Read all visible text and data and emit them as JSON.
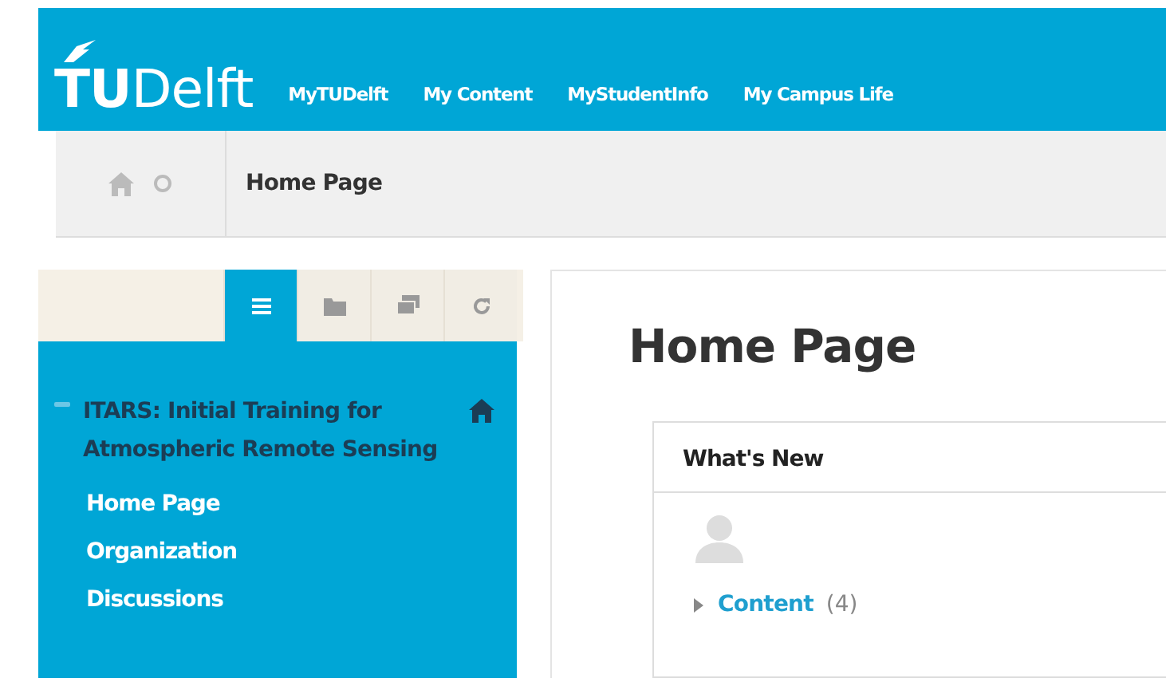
{
  "header": {
    "logo": "TUDelft",
    "nav": [
      "MyTUDelft",
      "My Content",
      "MyStudentInfo",
      "My Campus Life"
    ]
  },
  "breadcrumb": {
    "title": "Home Page"
  },
  "sidebar": {
    "tools": [
      {
        "kind": "list",
        "selected": true
      },
      {
        "kind": "folder",
        "selected": false
      },
      {
        "kind": "stack",
        "selected": false
      },
      {
        "kind": "refresh",
        "selected": false
      }
    ],
    "tree": [
      {
        "label": "ITARS: Initial Training for Atmospheric Remote Sensing",
        "expanded": true,
        "children": [
          {
            "label": "Home Page"
          },
          {
            "label": "Organization"
          },
          {
            "label": "Discussions"
          }
        ]
      }
    ]
  },
  "main": {
    "title": "Home Page",
    "widget": {
      "title": "What's New",
      "sections": [
        {
          "label": "Content",
          "count": "(4)",
          "expanded": false
        }
      ]
    }
  }
}
